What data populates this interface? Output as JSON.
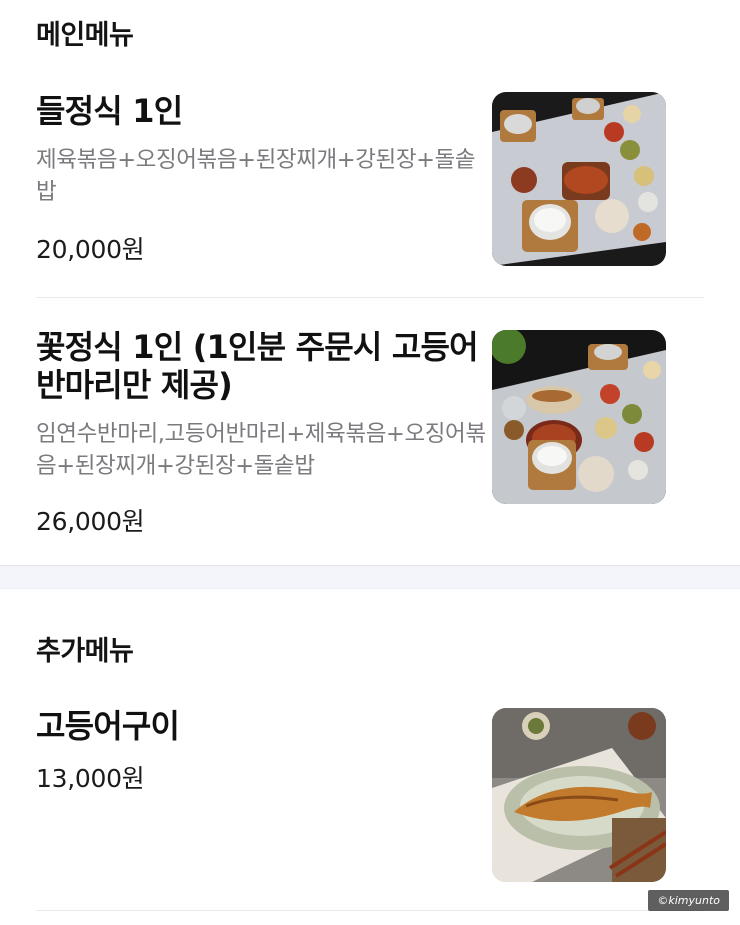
{
  "main_menu": {
    "title": "메인메뉴",
    "items": [
      {
        "name": "들정식 1인",
        "description": "제육볶음+오징어볶음+된장찌개+강된장+돌솥밥",
        "price": "20,000원",
        "image_icon": "korean-set-meal-photo"
      },
      {
        "name": "꽃정식 1인 (1인분 주문시 고등어 반마리만 제공)",
        "description": "임연수반마리,고등어반마리+제육볶음+오징어볶음+된장찌개+강된장+돌솥밥",
        "price": "26,000원",
        "image_icon": "korean-set-meal-photo"
      }
    ]
  },
  "extra_menu": {
    "title": "추가메뉴",
    "items": [
      {
        "name": "고등어구이",
        "price": "13,000원",
        "image_icon": "grilled-mackerel-photo"
      }
    ]
  },
  "watermark": "©kimyunto",
  "colors": {
    "title_text": "#111111",
    "description_text": "#7b7b7f",
    "divider_band": "#f4f5fa",
    "separator": "#e9e9ec"
  }
}
